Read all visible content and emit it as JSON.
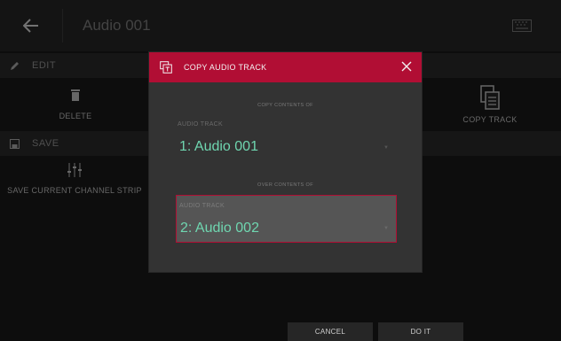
{
  "header": {
    "title": "Audio 001",
    "back_icon": "back-arrow-icon",
    "keyboard_icon": "keyboard-icon"
  },
  "sections": {
    "edit": {
      "label": "EDIT",
      "icon": "pencil-icon"
    },
    "save": {
      "label": "SAVE",
      "icon": "floppy-disk-icon"
    }
  },
  "actions": {
    "delete": {
      "label": "DELETE",
      "icon": "trash-icon"
    },
    "copy_track": {
      "label": "COPY TRACK",
      "icon": "copy-track-icon"
    },
    "save_channel_strip": {
      "label": "SAVE CURRENT CHANNEL STRIP",
      "icon": "mixer-sliders-icon"
    }
  },
  "dialog": {
    "title": "COPY AUDIO TRACK",
    "icon": "copy-track-icon",
    "copy_caption": "COPY CONTENTS OF",
    "source_label": "AUDIO TRACK",
    "source_value": "1: Audio 001",
    "over_caption": "OVER CONTENTS OF",
    "dest_label": "AUDIO TRACK",
    "dest_value": "2: Audio 002",
    "accent": "#b10e34",
    "value_color": "#6fd6b0"
  },
  "footer": {
    "cancel": "CANCEL",
    "do_it": "DO IT"
  }
}
